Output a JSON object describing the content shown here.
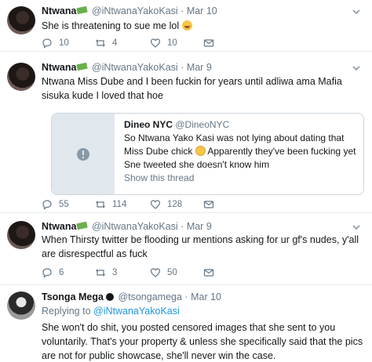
{
  "tweets": [
    {
      "name": "Ntwana",
      "handle": "@iNtwanaYakoKasi",
      "dot": "·",
      "date": "Mar 10",
      "text": "She is threatening to sue me lol",
      "replies": "10",
      "retweets": "4",
      "likes": "10"
    },
    {
      "name": "Ntwana",
      "handle": "@iNtwanaYakoKasi",
      "dot": "·",
      "date": "Mar 9",
      "text": "Ntwana Miss Dube and I been fuckin for years until adliwa ama Mafia sisuka kude I loved that hoe",
      "quote": {
        "name": "Dineo NYC",
        "handle": "@DineoNYC",
        "text_a": "So Ntwana Yako Kasi was not lying about dating that Miss Dube chick",
        "text_b": "Apparently they've been fucking yet Sne tweeted she doesn't know him",
        "link": "Show this thread"
      },
      "replies": "55",
      "retweets": "114",
      "likes": "128"
    },
    {
      "name": "Ntwana",
      "handle": "@iNtwanaYakoKasi",
      "dot": "·",
      "date": "Mar 9",
      "text": "When Thirsty twitter be flooding ur mentions asking for ur gf's nudes, y'all are disrespectful as fuck",
      "replies": "6",
      "retweets": "3",
      "likes": "50"
    },
    {
      "name": "Tsonga Mega",
      "handle": "@tsongamega",
      "dot": "·",
      "date": "Mar 10",
      "replying_label": "Replying to",
      "replying_handle": "@iNtwanaYakoKasi",
      "text": "She won't do shit, you posted censored images that she sent to you voluntarily. That's your property & unless she specifically said that the pics are not for public showcase, she'll never win the case."
    }
  ],
  "icons": {
    "reply": "reply-icon",
    "retweet": "retweet-icon",
    "like": "heart-icon",
    "message": "envelope-icon",
    "caret": "chevron-down-icon"
  }
}
